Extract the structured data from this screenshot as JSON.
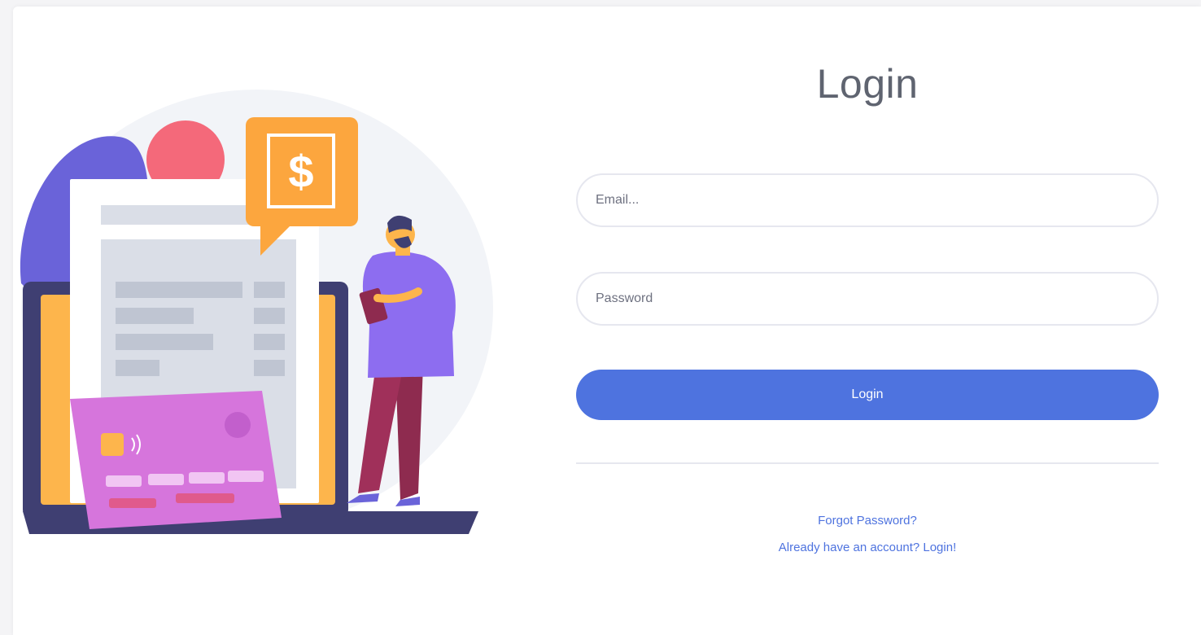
{
  "login": {
    "title": "Login",
    "email_placeholder": "Email...",
    "password_placeholder": "Password",
    "submit_label": "Login",
    "forgot_password_label": "Forgot Password?",
    "account_link_label": "Already have an account? Login!"
  },
  "illustration": {
    "icon": "dollar-sign-icon",
    "dollar_glyph": "$"
  },
  "colors": {
    "primary": "#4e73df",
    "title": "#5f6470",
    "field_border": "#e6e7ef",
    "card_background": "#ffffff",
    "page_background": "#f4f4f6"
  }
}
